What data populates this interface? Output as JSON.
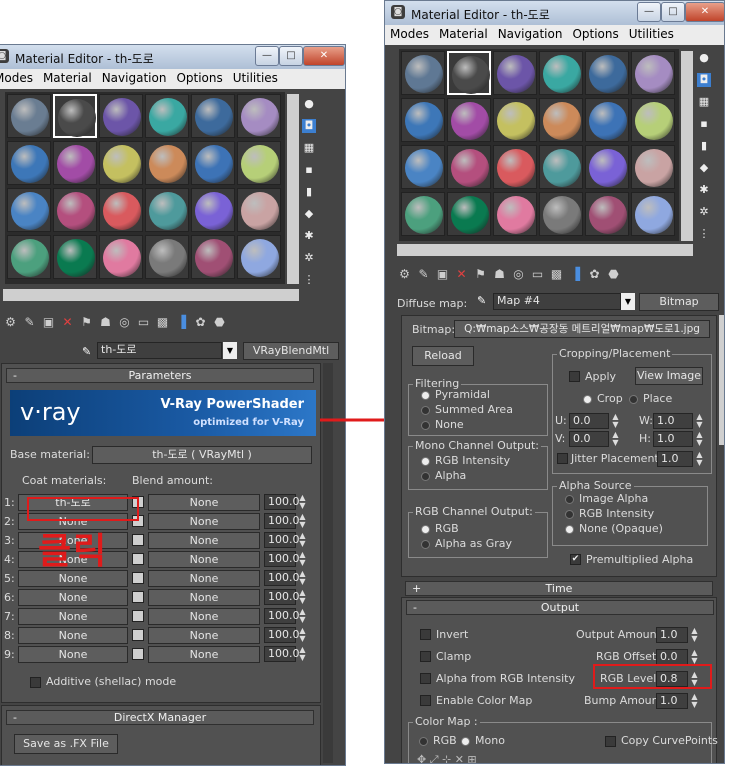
{
  "left_window": {
    "title": "Material Editor - th-도로",
    "menu": [
      "Modes",
      "Material",
      "Navigation",
      "Options",
      "Utilities"
    ],
    "material_name": "th-도로",
    "material_type": "VRayBlendMtl",
    "rollout_parameters": "Parameters",
    "banner_logo": "v·ray",
    "banner_title": "V-Ray PowerShader",
    "banner_sub": "optimized for V-Ray",
    "base_material_label": "Base material:",
    "base_material_value": "th-도로  ( VRayMtl )",
    "coat_materials_label": "Coat materials:",
    "blend_amount_label": "Blend amount:",
    "coats": [
      {
        "num": "1:",
        "mat": "th-도로",
        "blend": "None",
        "amount": "100.0"
      },
      {
        "num": "2:",
        "mat": "None",
        "blend": "None",
        "amount": "100.0"
      },
      {
        "num": "3:",
        "mat": "None",
        "blend": "None",
        "amount": "100.0"
      },
      {
        "num": "4:",
        "mat": "None",
        "blend": "None",
        "amount": "100.0"
      },
      {
        "num": "5:",
        "mat": "None",
        "blend": "None",
        "amount": "100.0"
      },
      {
        "num": "6:",
        "mat": "None",
        "blend": "None",
        "amount": "100.0"
      },
      {
        "num": "7:",
        "mat": "None",
        "blend": "None",
        "amount": "100.0"
      },
      {
        "num": "8:",
        "mat": "None",
        "blend": "None",
        "amount": "100.0"
      },
      {
        "num": "9:",
        "mat": "None",
        "blend": "None",
        "amount": "100.0"
      }
    ],
    "additive_label": "Additive (shellac) mode",
    "rollout_directx": "DirectX Manager",
    "save_fx_button": "Save as .FX File",
    "annotation_text": "클릭",
    "slot_colors": [
      [
        "#6a7d92",
        "#4a4a4a",
        "#6c55a8",
        "#3aa8a2",
        "#3d6a9c",
        "#a58cc2"
      ],
      [
        "#3d77b8",
        "#a24ca6",
        "#c4c060",
        "#cc8a5a",
        "#3d73b6",
        "#b6cf78"
      ],
      [
        "#4a84c4",
        "#b44f7e",
        "#d95a5e",
        "#4e9a9c",
        "#7a62d6",
        "#c9a3a3"
      ],
      [
        "#4ca07e",
        "#0a7a50",
        "#e07aa0",
        "#7a7a7a",
        "#a04f74",
        "#8fa8e0"
      ]
    ],
    "toolbar_icons": [
      "get-material-icon",
      "put-to-scene-icon",
      "assign-material-icon",
      "reset-icon",
      "make-unique-icon",
      "put-to-library-icon",
      "material-effects-icon",
      "show-map-icon",
      "show-end-result-icon",
      "go-parent-icon",
      "go-sibling-icon",
      "pick-material-icon"
    ],
    "side_icons": [
      "sample-type-icon",
      "backlight-icon",
      "background-icon",
      "uv-tiling-icon",
      "video-check-icon",
      "make-preview-icon",
      "options-icon",
      "select-by-material-icon",
      "material-map-navigator-icon"
    ]
  },
  "right_window": {
    "title": "Material Editor - th-도로",
    "menu": [
      "Modes",
      "Material",
      "Navigation",
      "Options",
      "Utilities"
    ],
    "diffuse_map_label": "Diffuse map:",
    "map_name": "Map #4",
    "map_type": "Bitmap",
    "bitmap_label": "Bitmap:",
    "bitmap_path": "Q:₩map소스₩공장동 메트리얼₩map₩도로1.jpg",
    "reload_button": "Reload",
    "cropping_title": "Cropping/Placement",
    "apply_label": "Apply",
    "view_image_button": "View Image",
    "crop_label": "Crop",
    "place_label": "Place",
    "u_label": "U:",
    "u_value": "0.0",
    "w_label": "W:",
    "w_value": "1.0",
    "v_label": "V:",
    "v_value": "0.0",
    "h_label": "H:",
    "h_value": "1.0",
    "jitter_label": "Jitter Placement:",
    "jitter_value": "1.0",
    "filtering_title": "Filtering",
    "filtering_options": [
      "Pyramidal",
      "Summed Area",
      "None"
    ],
    "mono_title": "Mono Channel Output:",
    "mono_options": [
      "RGB Intensity",
      "Alpha"
    ],
    "alpha_source_title": "Alpha Source",
    "alpha_source_options": [
      "Image Alpha",
      "RGB Intensity",
      "None (Opaque)"
    ],
    "rgb_channel_title": "RGB Channel Output:",
    "rgb_channel_options": [
      "RGB",
      "Alpha as Gray"
    ],
    "premult_label": "Premultiplied Alpha",
    "rollout_time": "Time",
    "rollout_output": "Output",
    "invert_label": "Invert",
    "clamp_label": "Clamp",
    "alpha_from_rgb_label": "Alpha from RGB Intensity",
    "enable_color_map_label": "Enable Color Map",
    "output_amount_label": "Output Amount:",
    "output_amount_value": "1.0",
    "rgb_offset_label": "RGB Offset:",
    "rgb_offset_value": "0.0",
    "rgb_level_label": "RGB Level:",
    "rgb_level_value": "0.8",
    "bump_amount_label": "Bump Amount:",
    "bump_amount_value": "1.0",
    "color_map_label": "Color Map :",
    "color_map_rgb": "RGB",
    "color_map_mono": "Mono",
    "copy_curvepoints_label": "Copy CurvePoints",
    "slot_colors": [
      [
        "#5f7894",
        "#4a4a4a",
        "#6c55a8",
        "#3aa8a2",
        "#3d6a9c",
        "#a58cc2"
      ],
      [
        "#3d77b8",
        "#a24ca6",
        "#c4c060",
        "#cc8a5a",
        "#3d73b6",
        "#b6cf78"
      ],
      [
        "#4a84c4",
        "#b44f7e",
        "#d95a5e",
        "#4e9a9c",
        "#7a62d6",
        "#c9a3a3"
      ],
      [
        "#4ca07e",
        "#0a7a50",
        "#e07aa0",
        "#7a7a7a",
        "#a04f74",
        "#8fa8e0"
      ]
    ]
  },
  "colors": {
    "annotation_red": "#e01b1b",
    "panel": "#515151",
    "highlight_blue": "#3c7fd0"
  }
}
